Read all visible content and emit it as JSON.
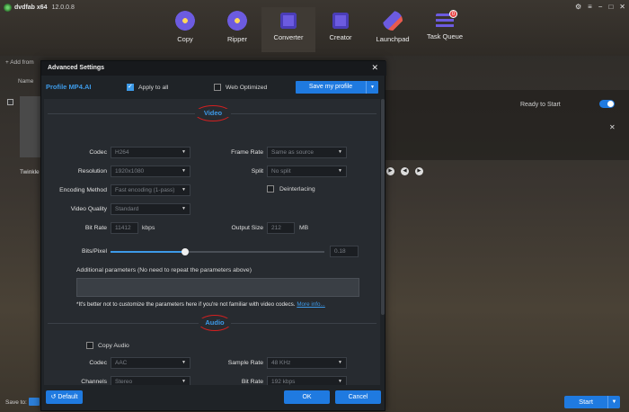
{
  "app": {
    "name": "dvdfab x64",
    "version": "12.0.0.8"
  },
  "nav": [
    {
      "label": "Copy",
      "icon": "disc-copy-icon"
    },
    {
      "label": "Ripper",
      "icon": "disc-ripper-icon"
    },
    {
      "label": "Converter",
      "icon": "film-converter-icon"
    },
    {
      "label": "Creator",
      "icon": "film-creator-icon"
    },
    {
      "label": "Launchpad",
      "icon": "rocket-icon"
    },
    {
      "label": "Task Queue",
      "icon": "task-queue-icon",
      "badge": "0"
    }
  ],
  "background": {
    "add_from": "+ Add from",
    "name_header": "Name",
    "ready_text": "Ready to Start",
    "file_name": "Twinkle",
    "save_to": "Save to:",
    "start": "Start"
  },
  "modal": {
    "title": "Advanced Settings",
    "profile_label": "Profile",
    "profile_value": "MP4.AI",
    "apply_to_all": "Apply to all",
    "apply_to_all_checked": true,
    "web_optimized": "Web Optimized",
    "web_optimized_checked": false,
    "save_profile": "Save my profile",
    "video": {
      "section": "Video",
      "codec_label": "Codec",
      "codec": "H264",
      "resolution_label": "Resolution",
      "resolution": "1920x1080",
      "encoding_label": "Encoding Method",
      "encoding": "Fast encoding (1-pass)",
      "quality_label": "Video Quality",
      "quality": "Standard",
      "bitrate_label": "Bit Rate",
      "bitrate": "11412",
      "bitrate_unit": "kbps",
      "framerate_label": "Frame Rate",
      "framerate": "Same as source",
      "split_label": "Split",
      "split": "No split",
      "deinterlacing": "Deinterlacing",
      "deinterlacing_checked": false,
      "outsize_label": "Output Size",
      "outsize": "212",
      "outsize_unit": "MB",
      "bpp_label": "Bits/Pixel",
      "bpp": "0.18",
      "bpp_level": 0.35,
      "addl_params": "Additional parameters (No need to repeat the parameters above)",
      "note": "*It's better not to customize the parameters here if you're not familiar with video codecs.",
      "more_info": "More info..."
    },
    "audio": {
      "section": "Audio",
      "copy_audio": "Copy Audio",
      "copy_audio_checked": false,
      "codec_label": "Codec",
      "codec": "AAC",
      "channels_label": "Channels",
      "channels": "Stereo",
      "samplerate_label": "Sample Rate",
      "samplerate": "48 KHz",
      "bitrate_label": "Bit Rate",
      "bitrate": "192 kbps"
    },
    "default": "Default",
    "ok": "OK",
    "cancel": "Cancel"
  }
}
